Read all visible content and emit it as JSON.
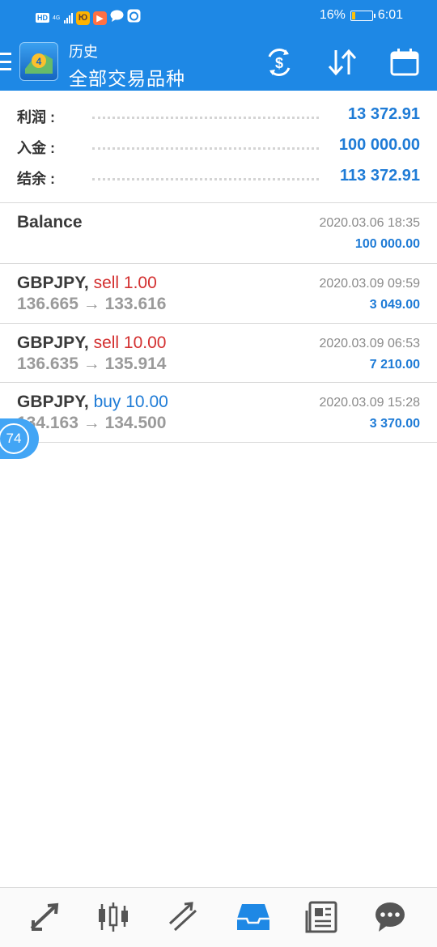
{
  "status_bar": {
    "hd": "HD",
    "network": "4G",
    "app_icon_1": "Ю",
    "app_icon_2": "▶",
    "battery": "16%",
    "time": "6:01",
    "colors": {
      "app_icon_1": "#ffb300",
      "app_icon_2": "#ff7043",
      "battery_fill": "#ffc107"
    }
  },
  "header": {
    "subtitle": "历史",
    "title": "全部交易品种",
    "icons": [
      "menu-icon",
      "metatrader-logo-icon",
      "currency-exchange-icon",
      "sort-icon",
      "calendar-icon"
    ]
  },
  "summary": [
    {
      "label": "利润 :",
      "value": "13 372.91"
    },
    {
      "label": "入金 :",
      "value": "100 000.00"
    },
    {
      "label": "结余 :",
      "value": "113 372.91"
    }
  ],
  "balance": {
    "label": "Balance",
    "time": "2020.03.06 18:35",
    "amount": "100 000.00"
  },
  "deals": [
    {
      "symbol": "GBPJPY,",
      "side": "sell 1.00",
      "prices": "136.665 → 133.616",
      "time": "2020.03.09 09:59",
      "profit": "3 049.00"
    },
    {
      "symbol": "GBPJPY,",
      "side": "sell 10.00",
      "prices": "136.635 → 135.914",
      "time": "2020.03.09 06:53",
      "profit": "7 210.00"
    },
    {
      "symbol": "GBPJPY,",
      "side": "buy 10.00",
      "prices": "134.163 → 134.500",
      "time": "2020.03.09 15:28",
      "profit": "3 370.00"
    }
  ],
  "floating_badge": "74",
  "bottom_nav": {
    "items": [
      "quotes-icon",
      "chart-icon",
      "trade-icon",
      "history-icon",
      "news-icon",
      "chat-icon"
    ],
    "active": "history-icon",
    "active_color": "#1e88e5",
    "inactive_color": "#555555"
  },
  "colors": {
    "accent": "#1e88e5",
    "profit": "#1e7bd6",
    "sell": "#d32f2f",
    "buy": "#1e7bd6"
  }
}
